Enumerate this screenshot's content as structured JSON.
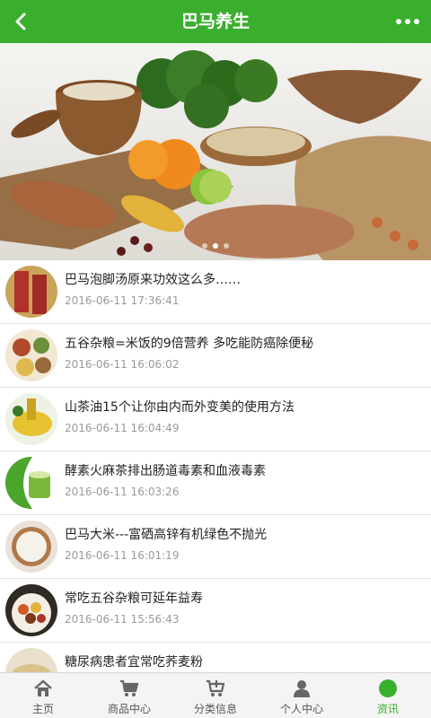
{
  "header": {
    "title": "巴马养生"
  },
  "banner": {
    "slides": 3,
    "active_slide": 2
  },
  "articles": [
    {
      "title": "巴马泡脚汤原来功效这么多……",
      "date": "2016-06-11 17:36:41"
    },
    {
      "title": "五谷杂粮=米饭的9倍营养 多吃能防癌除便秘",
      "date": "2016-06-11 16:06:02"
    },
    {
      "title": "山茶油15个让你由内而外变美的使用方法",
      "date": "2016-06-11 16:04:49"
    },
    {
      "title": "酵素火麻茶排出肠道毒素和血液毒素",
      "date": "2016-06-11 16:03:26"
    },
    {
      "title": "巴马大米---富硒高锌有机绿色不抛光",
      "date": "2016-06-11 16:01:19"
    },
    {
      "title": "常吃五谷杂粮可延年益寿",
      "date": "2016-06-11 15:56:43"
    },
    {
      "title": "糖尿病患者宜常吃荞麦粉",
      "date": ""
    }
  ],
  "tabs": [
    {
      "label": "主页",
      "icon": "home-icon"
    },
    {
      "label": "商品中心",
      "icon": "cart-icon"
    },
    {
      "label": "分类信息",
      "icon": "cart-plus-icon"
    },
    {
      "label": "个人中心",
      "icon": "user-icon"
    },
    {
      "label": "资讯",
      "icon": "news-dot-icon"
    }
  ],
  "colors": {
    "brand": "#3aae2d"
  }
}
